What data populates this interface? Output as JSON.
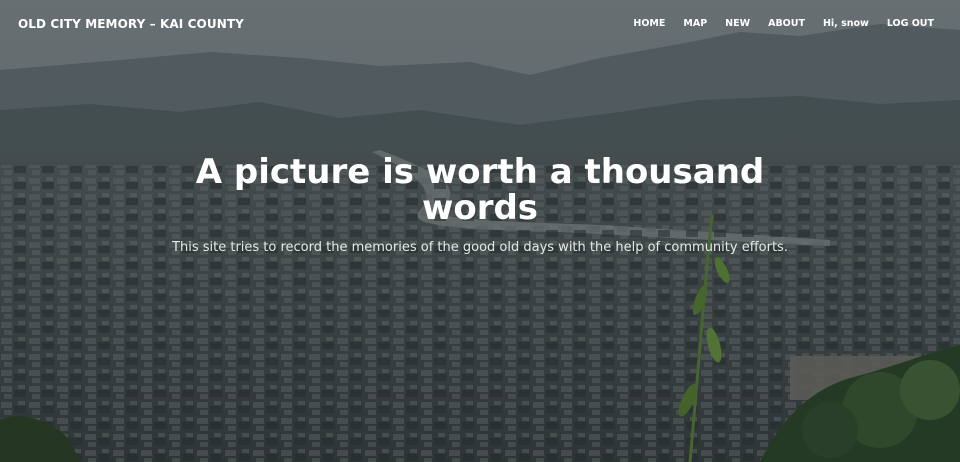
{
  "navbar": {
    "brand": "OLD CITY MEMORY – KAI COUNTY",
    "links": [
      "HOME",
      "MAP",
      "NEW",
      "ABOUT",
      "Hi, snow",
      "LOG OUT"
    ]
  },
  "hero": {
    "heading": "A picture is worth a thousand words",
    "subheading": "This site tries to record the memories of the good old days with the help of community efforts."
  },
  "colors": {
    "text": "#ffffff",
    "overlay": "#14181a"
  }
}
